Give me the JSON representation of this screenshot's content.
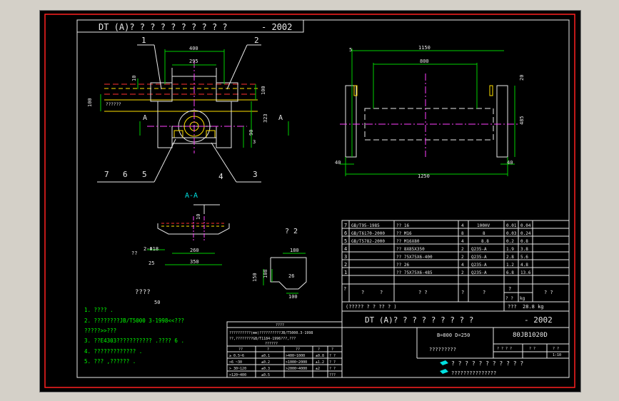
{
  "title_strip": {
    "text": "DT (A)? ? ? ? ? ? ? ? ? ?",
    "year": "- 2002"
  },
  "callouts": {
    "c1": "1",
    "c2": "2",
    "c3": "3",
    "c4": "4",
    "c5": "5",
    "c6": "6",
    "c7": "7"
  },
  "front_view": {
    "d400": "400",
    "d295": "295",
    "d10": "10",
    "d100": "100",
    "d100b": "100",
    "d323": "323",
    "d90": "90",
    "d3": "3",
    "note": "??????",
    "section_left": "A",
    "section_right": "A"
  },
  "side_view": {
    "d5": "5",
    "d1150": "1150",
    "d800": "800",
    "d20": "20",
    "d485": "485",
    "d40a": "40",
    "d40b": "40",
    "d1250": "1250"
  },
  "section_aa": {
    "label": "A-A",
    "d10": "10",
    "d260": "260",
    "d350": "350",
    "d25": "25",
    "hole": "2-Φ18",
    "q": "??"
  },
  "detail2": {
    "label": "? 2",
    "d180": "180",
    "d150": "150",
    "d108": "108",
    "d26": "26",
    "d100": "100"
  },
  "notes": {
    "heading": "????",
    "scale": "50",
    "items": [
      "1. ???? .",
      "2. ????????JB/T5000 3-1998<<???",
      "   ?????>>???",
      "3. ??E4303??????????? .???? 6 .",
      "4. ????????????? .",
      "5. ??? ,?????? ."
    ]
  },
  "bom": {
    "rows": [
      {
        "no": "7",
        "code": "GB/T95-1985",
        "name": "?? 16",
        "qty": "4",
        "mat": "100HV",
        "w1": "0.01",
        "w2": "0.04"
      },
      {
        "no": "6",
        "code": "GB/T6170-2000",
        "name": "?? M16",
        "qty": "8",
        "mat": "8",
        "w1": "0.03",
        "w2": "0.24"
      },
      {
        "no": "5",
        "code": "GB/T5782-2000",
        "name": "?? M16X80",
        "qty": "4",
        "mat": "8.8",
        "w1": "0.2",
        "w2": "0.8"
      },
      {
        "no": "4",
        "code": "",
        "name": "?? 8X85X350",
        "qty": "2",
        "mat": "Q235-A",
        "w1": "1.9",
        "w2": "3.8"
      },
      {
        "no": "3",
        "code": "",
        "name": "?? 75X75X6-400",
        "qty": "2",
        "mat": "Q235-A",
        "w1": "2.8",
        "w2": "5.6"
      },
      {
        "no": "2",
        "code": "",
        "name": "?? 26",
        "qty": "4",
        "mat": "Q235-A",
        "w1": "1.2",
        "w2": "4.8"
      },
      {
        "no": "1",
        "code": "",
        "name": "?? 75X75X6-485",
        "qty": "2",
        "mat": "Q235-A",
        "w1": "6.8",
        "w2": "13.6"
      }
    ],
    "head": {
      "a": "?",
      "b": "?",
      "c": "?",
      "d": "? ?",
      "e": "?",
      "f": "?",
      "g": "?",
      "h": "? ?",
      "kg": "kg",
      "i": "? ?"
    },
    "total_left": "(????? ? ? ??  ? )",
    "total_label": "???",
    "total_value": "28.8 kg"
  },
  "title_block": {
    "title": "DT (A)? ? ? ? ? ? ? ? ?",
    "year": "- 2002",
    "params": "B=800 D=250",
    "code": "80JB1020D",
    "name": "?????????",
    "r1": "? ? ? ?",
    "r2": "? ?",
    "r3": "? ?",
    "scale": "1:10",
    "company1": "? ? ? ? ? ? ? ? ? ? ?",
    "company2": "???????????????"
  },
  "tol_table": {
    "title": "????",
    "line1": "??????????(mm)??????????JB/T5000.3-1998",
    "line2": "??,????????GB/T1184-1996???,???",
    "line3": "??????",
    "heads": [
      "??",
      "?",
      "??",
      "?",
      "?",
      "?"
    ],
    "rows": [
      [
        "≥ 0.5~6",
        "±0.1",
        ">400~1000",
        "±0.8",
        "? ?",
        "? ?"
      ],
      [
        ">6 ~30",
        "±0.2",
        ">1000~2000",
        "±1.2",
        "? ?",
        "??"
      ],
      [
        "> 30~120",
        "±0.3",
        ">2000~4000",
        "±2",
        "? ?",
        "??"
      ],
      [
        ">120~400",
        "±0.5",
        "",
        "",
        "???",
        "? ?"
      ]
    ]
  }
}
